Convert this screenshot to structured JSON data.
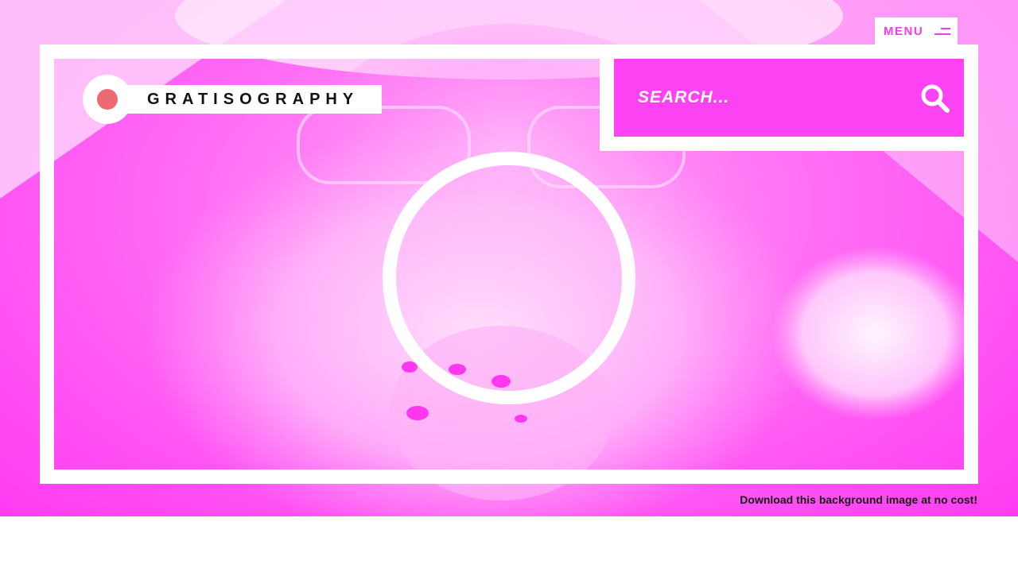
{
  "header": {
    "menu_label": "MENU",
    "menu_icon": "hamburger-icon"
  },
  "logo": {
    "text": "GRATISOGRAPHY",
    "dot_color": "#ee6a73"
  },
  "search": {
    "placeholder": "SEARCH...",
    "value": "",
    "icon": "search-icon"
  },
  "hero": {
    "image_description_icon": "santa-photo",
    "accent_color": "#fb43f4"
  },
  "footer": {
    "download_text": "Download this background image at no cost!"
  }
}
